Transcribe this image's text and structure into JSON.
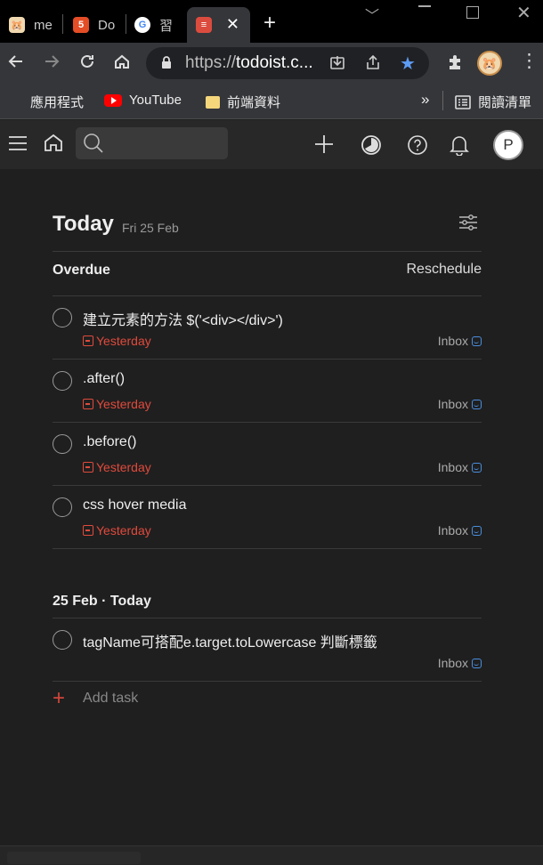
{
  "browser": {
    "tabs": [
      {
        "title": "me",
        "icon": "hamster-favicon"
      },
      {
        "title": "Do",
        "icon": "html5-favicon"
      },
      {
        "title": "習",
        "icon": "google-favicon"
      },
      {
        "title": "",
        "icon": "todoist-favicon",
        "active": true
      }
    ],
    "tab_close": "✕",
    "url_scheme": "https://",
    "url_host": "todoist.c...",
    "bookmarks": [
      {
        "label": "應用程式",
        "icon": "apps-grid-icon"
      },
      {
        "label": "YouTube",
        "icon": "youtube-icon"
      },
      {
        "label": "前端資料",
        "icon": "folder-icon"
      }
    ],
    "overflow": "»",
    "reading_list": "閱讀清單"
  },
  "app": {
    "avatar_letter": "P"
  },
  "page": {
    "title": "Today",
    "date": "Fri 25 Feb"
  },
  "overdue": {
    "heading": "Overdue",
    "reschedule": "Reschedule",
    "tasks": [
      {
        "title": "建立元素的方法 $('<div></div>')",
        "due": "Yesterday",
        "project": "Inbox"
      },
      {
        "title": ".after()",
        "due": "Yesterday",
        "project": "Inbox"
      },
      {
        "title": ".before()",
        "due": "Yesterday",
        "project": "Inbox"
      },
      {
        "title": "css hover media",
        "due": "Yesterday",
        "project": "Inbox"
      }
    ]
  },
  "today_section": {
    "heading": "25 Feb · Today",
    "tasks": [
      {
        "title": "tagName可搭配e.target.toLowercase 判斷標籤",
        "project": "Inbox"
      }
    ]
  },
  "add_task_label": "Add task",
  "colors": {
    "overdue_red": "#e04a3c",
    "inbox_blue": "#4a8ede",
    "accent_red": "#d1453b",
    "background": "#1f1f1f"
  }
}
